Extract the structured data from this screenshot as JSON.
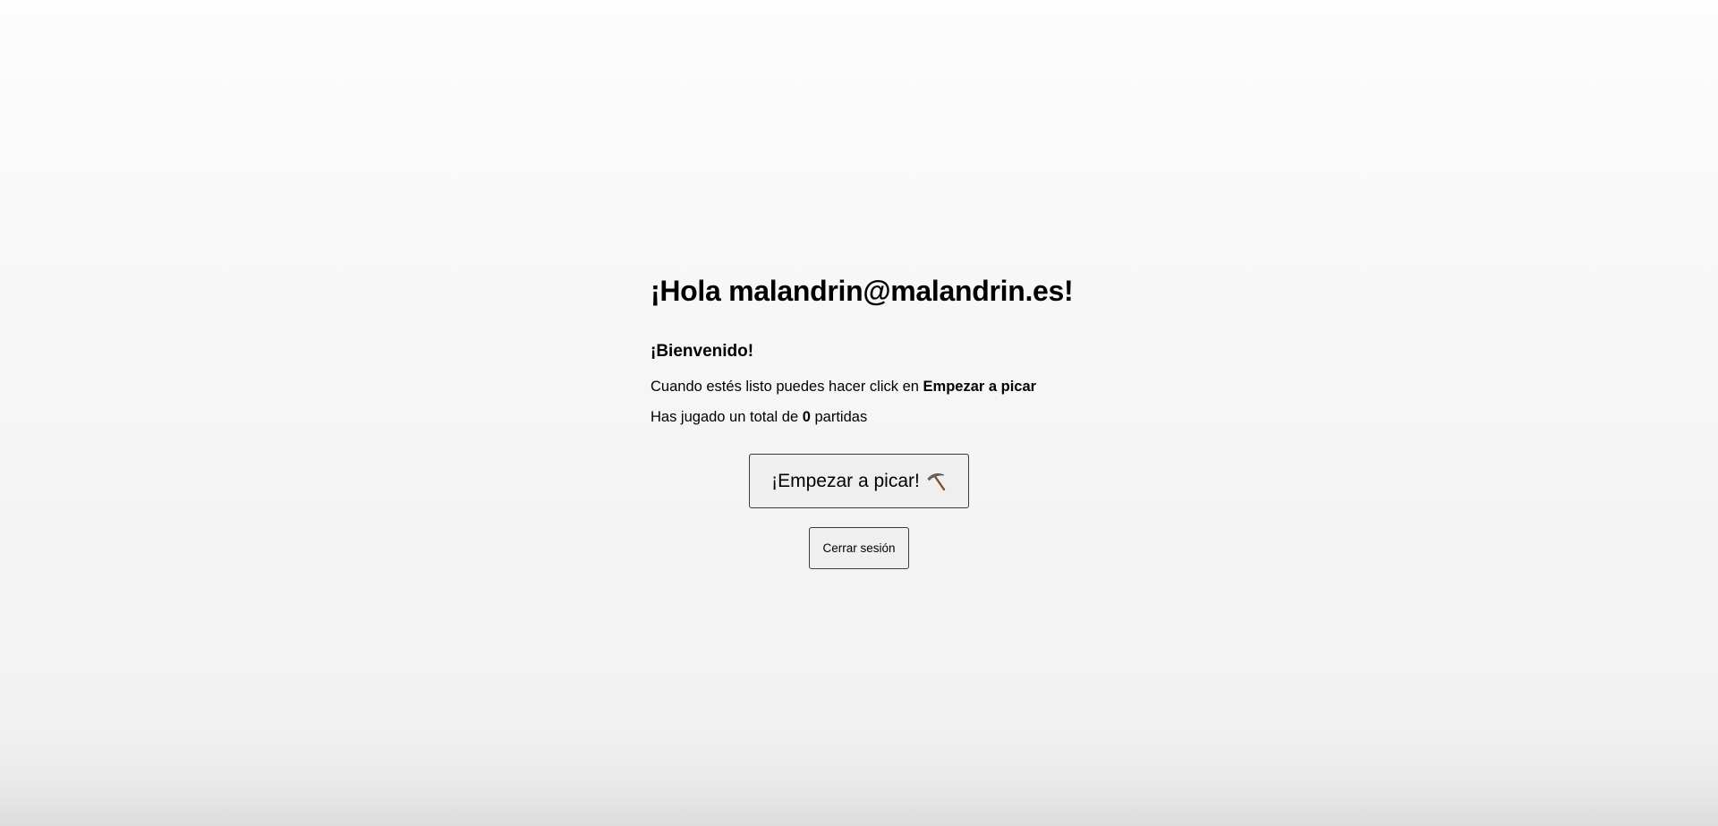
{
  "greeting": {
    "prefix": "¡Hola ",
    "email": "malandrin@malandrin.es",
    "suffix": "!"
  },
  "welcome": "¡Bienvenido!",
  "instructions": {
    "text": "Cuando estés listo puedes hacer click en ",
    "highlight": "Empezar a picar"
  },
  "games_played": {
    "prefix": "Has jugado un total de ",
    "count": "0",
    "suffix": " partidas"
  },
  "start_button": {
    "label": "¡Empezar a picar!",
    "icon": "pickaxe-icon"
  },
  "logout_button": {
    "label": "Cerrar sesión"
  }
}
